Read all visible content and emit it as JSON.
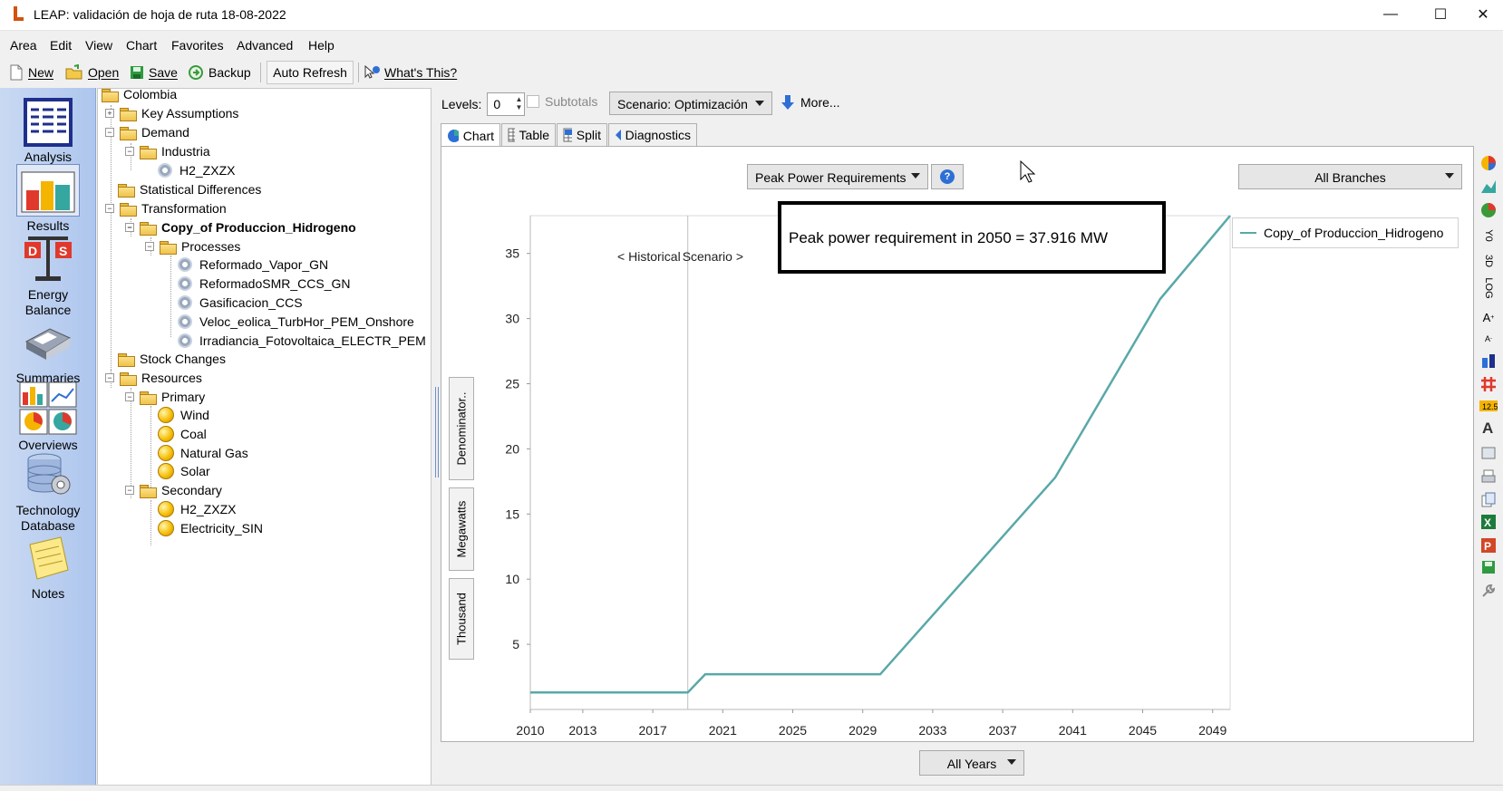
{
  "window": {
    "title": "LEAP: validación de hoja de ruta 18-08-2022",
    "minimize_glyph": "—",
    "maximize_glyph": "☐",
    "close_glyph": "✕"
  },
  "menu": [
    "Area",
    "Edit",
    "View",
    "Chart",
    "Favorites",
    "Advanced",
    "Help"
  ],
  "toolbar": {
    "new_label": "New",
    "open_label": "Open",
    "save_label": "Save",
    "backup_label": "Backup",
    "auto_refresh_label": "Auto Refresh",
    "whats_this_label": "What's This?"
  },
  "views": {
    "analysis": "Analysis",
    "results": "Results",
    "energy_balance_1": "Energy",
    "energy_balance_2": "Balance",
    "summaries": "Summaries",
    "overviews": "Overviews",
    "technology_db_1": "Technology",
    "technology_db_2": "Database",
    "notes": "Notes"
  },
  "tree": {
    "colombia": "Colombia",
    "key_assumptions": "Key Assumptions",
    "demand": "Demand",
    "industria": "Industria",
    "h2_zxzx_demand": "H2_ZXZX",
    "statistical_differences": "Statistical Differences",
    "transformation": "Transformation",
    "copy_produccion": "Copy_of Produccion_Hidrogeno",
    "processes": "Processes",
    "p1": "Reformado_Vapor_GN",
    "p2": "ReformadoSMR_CCS_GN",
    "p3": "Gasificacion_CCS",
    "p4": "Veloc_eolica_TurbHor_PEM_Onshore",
    "p5": "Irradiancia_Fotovoltaica_ELECTR_PEM",
    "stock_changes": "Stock Changes",
    "resources": "Resources",
    "primary": "Primary",
    "wind": "Wind",
    "coal": "Coal",
    "natural_gas": "Natural Gas",
    "solar": "Solar",
    "secondary": "Secondary",
    "h2_zxzx_res": "H2_ZXZX",
    "electricity_sin": "Electricity_SIN"
  },
  "controls": {
    "levels_label": "Levels:",
    "levels_value": "0",
    "subtotals_label": "Subtotals",
    "scenario_label": "Scenario: Optimización",
    "more_label": "More..."
  },
  "tabs": {
    "chart": "Chart",
    "table": "Table",
    "split": "Split",
    "diagnostics": "Diagnostics"
  },
  "chart_panel": {
    "variable": "Peak Power Requirements",
    "branches": "All Branches",
    "years": "All Years",
    "annotation": "Peak power requirement in 2050 = 37.916  MW",
    "unit_labels": {
      "denominator": "Denominator..",
      "megawatts": "Megawatts",
      "thousand": "Thousand"
    }
  },
  "chart_data": {
    "type": "line",
    "x": [
      2010,
      2019,
      2020,
      2030,
      2040,
      2046,
      2050
    ],
    "series": [
      {
        "name": "Copy_of Produccion_Hidrogeno",
        "values": [
          1.3,
          1.3,
          2.7,
          2.7,
          17.8,
          31.5,
          37.9
        ],
        "color": "#5aa8a8"
      }
    ],
    "x_ticks": [
      2010,
      2013,
      2017,
      2021,
      2025,
      2029,
      2033,
      2037,
      2041,
      2045,
      2049
    ],
    "y_ticks": [
      5,
      10,
      15,
      20,
      25,
      30,
      35
    ],
    "xlim": [
      2010,
      2050
    ],
    "ylim": [
      0,
      37.9
    ],
    "divider_x": 2019,
    "historical_label": "< Historical",
    "scenario_label": "Scenario >",
    "xlabel": "",
    "ylabel": "",
    "title": "",
    "grid": false,
    "legend_position": "right"
  }
}
